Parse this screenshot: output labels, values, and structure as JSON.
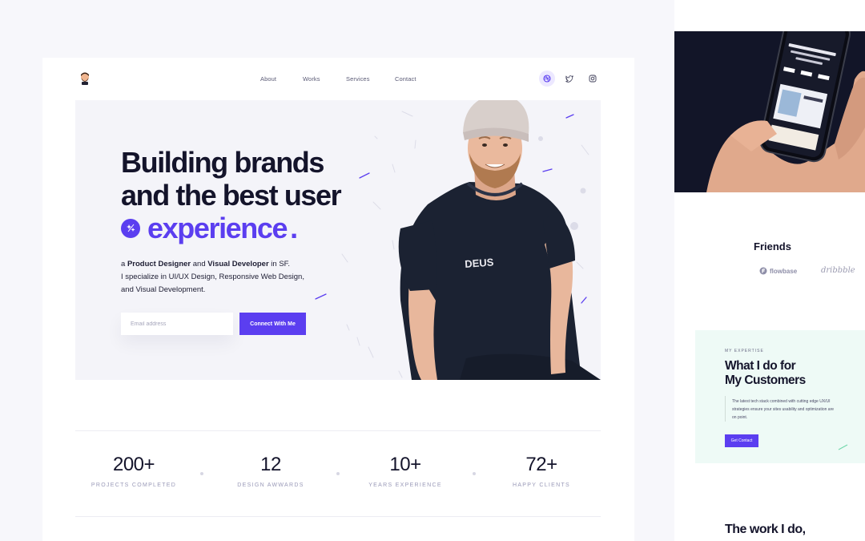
{
  "nav": {
    "links": [
      "About",
      "Works",
      "Services",
      "Contact"
    ],
    "social_icons": [
      "dribbble-icon",
      "twitter-icon",
      "instagram-icon"
    ]
  },
  "hero": {
    "title_line1": "Building brands",
    "title_line2": "and the best user",
    "title_accent": "experience",
    "title_dot": ".",
    "desc": {
      "prefix": "a ",
      "role1": "Product Designer",
      "and": " and ",
      "role2": "Visual Developer",
      "suffix": " in SF.",
      "line2": "I specialize in UI/UX Design, Responsive Web Design,",
      "line3": "and Visual Development."
    },
    "email_placeholder": "Email address",
    "cta": "Connect With Me",
    "shirt_text": "DEUS"
  },
  "stats": [
    {
      "value": "200+",
      "label": "PROJECTS COMPLETED"
    },
    {
      "value": "12",
      "label": "DESIGN AWWARDS"
    },
    {
      "value": "10+",
      "label": "YEARS EXPERIENCE"
    },
    {
      "value": "72+",
      "label": "HAPPY CLIENTS"
    }
  ],
  "side": {
    "friends_title": "Friends",
    "friends_logos": [
      "flowbase",
      "dribbble"
    ],
    "expertise_tag": "MY EXPERTISE",
    "expertise_title_1": "What I do for",
    "expertise_title_2": "My Customers",
    "expertise_text": "The latest tech stack combined with cutting edge UX/UI strategies ensure your sites usability and optimization are on point.",
    "expertise_cta": "Get Contact",
    "work_title": "The work I do,"
  },
  "colors": {
    "accent": "#5b3ef0",
    "dark": "#14142b",
    "hero_bg": "#f4f4f9",
    "mint": "#eefaf6"
  }
}
